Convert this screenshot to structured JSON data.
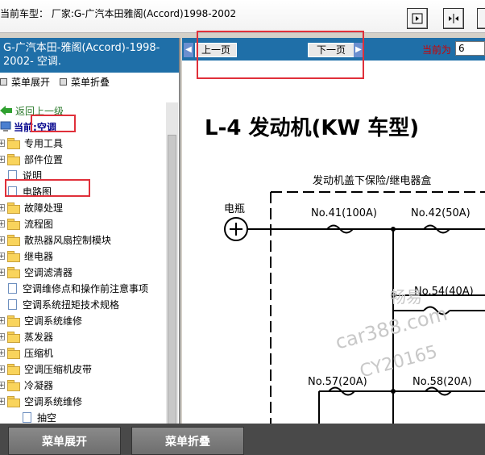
{
  "header": {
    "title": "当前车型：  厂家:G-广汽本田雅阁(Accord)1998-2002"
  },
  "toolbar": {
    "icons": [
      "expand-icon",
      "split-icon",
      "collapse-icon"
    ]
  },
  "left_panel": {
    "header_text": "G-广汽本田-雅阁(Accord)-1998-2002- 空调.",
    "expand_all": "菜单展开",
    "collapse_all": "菜单折叠",
    "back": "返回上一级",
    "current_prefix": "当前:",
    "current_value": "空调",
    "items": [
      {
        "label": "专用工具",
        "type": "folder"
      },
      {
        "label": "部件位置",
        "type": "folder"
      },
      {
        "label": "说明",
        "type": "doc"
      },
      {
        "label": "电路图",
        "type": "doc"
      },
      {
        "label": "故障处理",
        "type": "folder"
      },
      {
        "label": "流程图",
        "type": "folder"
      },
      {
        "label": "散热器风扇控制模块",
        "type": "folder"
      },
      {
        "label": "继电器",
        "type": "folder"
      },
      {
        "label": "空调滤清器",
        "type": "folder"
      },
      {
        "label": "空调维修点和操作前注意事项",
        "type": "doc"
      },
      {
        "label": "空调系统扭矩技术规格",
        "type": "doc"
      },
      {
        "label": "空调系统维修",
        "type": "folder"
      },
      {
        "label": "蒸发器",
        "type": "folder"
      },
      {
        "label": "压缩机",
        "type": "folder"
      },
      {
        "label": "空调压缩机皮带",
        "type": "folder"
      },
      {
        "label": "冷凝器",
        "type": "folder"
      },
      {
        "label": "空调系统维修",
        "type": "folder"
      },
      {
        "label": "抽空",
        "type": "doc"
      }
    ]
  },
  "viewer": {
    "prev": "上一页",
    "next": "下一页",
    "current_page_label": "当前为",
    "current_page": "6"
  },
  "diagram": {
    "title": "L-4 发动机(KW 车型)",
    "box_label": "发动机盖下保险/继电器盒",
    "battery": "电瓶",
    "fuses": [
      "No.41(100A)",
      "No.42(50A)",
      "No.54(40A)",
      "No.57(20A)",
      "No.58(20A)"
    ],
    "watermark1": "畅易",
    "watermark2": "car388.com",
    "watermark3": "CY20165"
  },
  "bottom": {
    "expand": "菜单展开",
    "collapse": "菜单折叠"
  },
  "colors": {
    "accent": "#1f6fa8",
    "highlight": "#e0303a"
  }
}
